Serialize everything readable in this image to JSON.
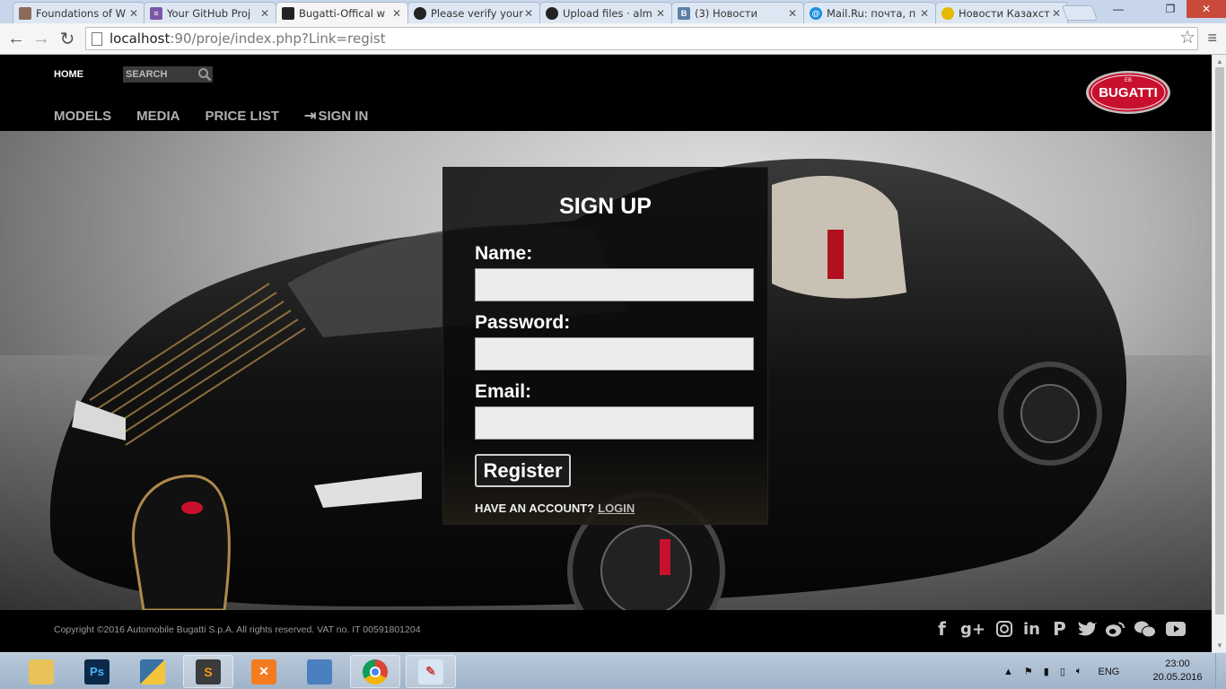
{
  "browser": {
    "tabs": [
      {
        "title": "Foundations of W",
        "favicon": "foundations-favicon",
        "color": "#8a6a5a"
      },
      {
        "title": "Your GitHub Proj",
        "favicon": "form-favicon",
        "color": "#7b57a6"
      },
      {
        "title": "Bugatti-Offical w",
        "favicon": "car-favicon",
        "color": "#222222",
        "active": true
      },
      {
        "title": "Please verify your",
        "favicon": "github-favicon",
        "color": "#222222"
      },
      {
        "title": "Upload files · alm",
        "favicon": "github-favicon",
        "color": "#222222"
      },
      {
        "title": "(3) Новости",
        "favicon": "vk-favicon",
        "color": "#5b7fa6"
      },
      {
        "title": "Mail.Ru: почта, п",
        "favicon": "mailru-favicon",
        "color": "#168de2"
      },
      {
        "title": "Новости Казахст",
        "favicon": "news-favicon",
        "color": "#e6b800"
      }
    ],
    "url_host": "localhost",
    "url_path": ":90/proje/index.php?Link=regist"
  },
  "site": {
    "home_label": "HOME",
    "search_placeholder": "SEARCH",
    "nav": [
      "MODELS",
      "MEDIA",
      "PRICE LIST",
      "SIGN IN"
    ],
    "logo_text": "BUGATTI",
    "brand_red": "#c8102e"
  },
  "signup": {
    "title": "SIGN UP",
    "name_label": "Name:",
    "name_value": "",
    "password_label": "Password:",
    "password_value": "",
    "email_label": "Email:",
    "email_value": "",
    "register_label": "Register",
    "have_account": "HAVE AN ACCOUNT?",
    "login_label": "LOGIN"
  },
  "footer": {
    "copyright": "Copyright ©2016 Automobile Bugatti S.p.A. All rights reserved. VAT no. IT 00591801204",
    "socials": [
      "facebook-icon",
      "google-plus-icon",
      "instagram-icon",
      "linkedin-icon",
      "pinterest-icon",
      "twitter-icon",
      "weibo-icon",
      "wechat-icon",
      "youtube-icon"
    ]
  },
  "taskbar": {
    "apps": [
      "explorer",
      "photoshop",
      "python",
      "sublime",
      "xampp",
      "virtualbox",
      "chrome",
      "paint"
    ],
    "lang": "ENG",
    "time": "23:00",
    "date": "20.05.2016"
  }
}
